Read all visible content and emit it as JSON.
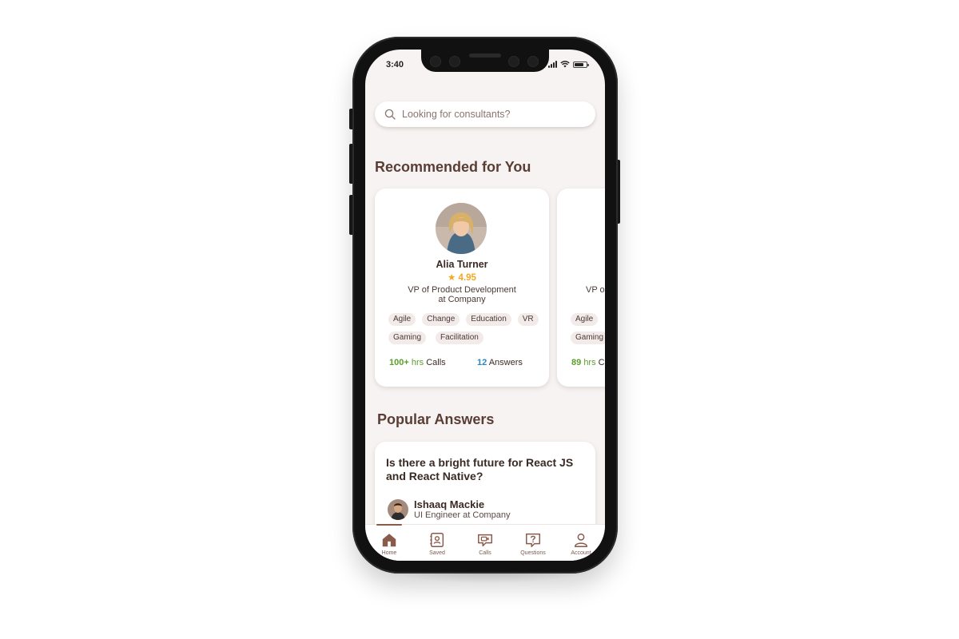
{
  "status_bar": {
    "time": "3:40"
  },
  "search": {
    "placeholder": "Looking for consultants?"
  },
  "recommended": {
    "title": "Recommended for You",
    "cards": [
      {
        "name": "Alia Turner",
        "rating": "★ 4.95",
        "role_line1": "VP of Product Development",
        "role_line2": "at Company",
        "tags": [
          "Agile",
          "Change",
          "Education",
          "VR",
          "Gaming",
          "Facilitation"
        ],
        "calls_value": "100+",
        "calls_unit": "hrs",
        "calls_label": "Calls",
        "answers_value": "12",
        "answers_label": "Answers"
      },
      {
        "role_line1": "VP o",
        "tags": [
          "Agile",
          "Gaming"
        ],
        "calls_value": "89",
        "calls_unit": "hrs",
        "calls_label": "C"
      }
    ]
  },
  "popular": {
    "title": "Popular Answers",
    "question": "Is there a bright future for React JS and React Native?",
    "author_name": "Ishaaq Mackie",
    "author_role": "UI Engineer at Company"
  },
  "tabbar": {
    "items": [
      {
        "label": "Home",
        "icon": "home-icon",
        "active": true
      },
      {
        "label": "Saved",
        "icon": "saved-icon",
        "active": false
      },
      {
        "label": "Calls",
        "icon": "calls-icon",
        "active": false
      },
      {
        "label": "Questions",
        "icon": "questions-icon",
        "active": false
      },
      {
        "label": "Account",
        "icon": "account-icon",
        "active": false
      }
    ]
  },
  "colors": {
    "brand_brown": "#5a3e36",
    "rating": "#f3a821",
    "calls_green": "#5c9e2a",
    "answers_blue": "#2d86c4",
    "background": "#f6f3f2"
  }
}
